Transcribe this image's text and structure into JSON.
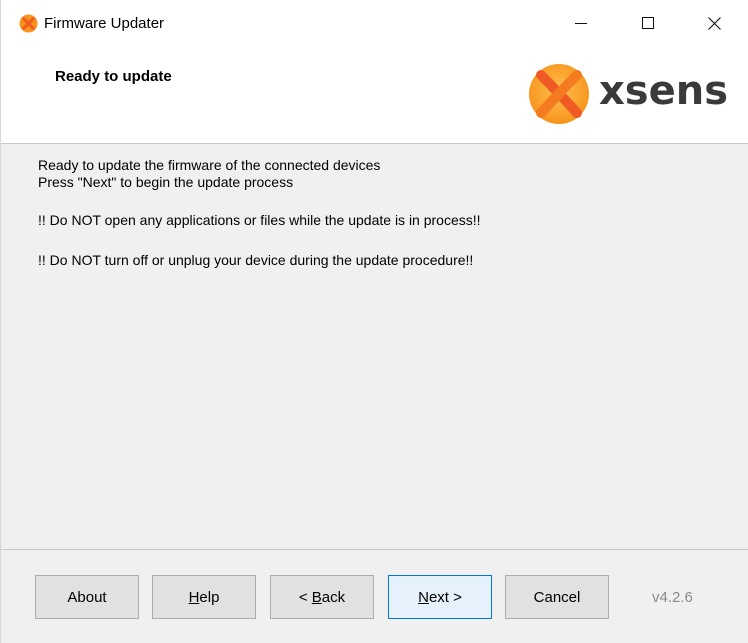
{
  "window": {
    "title": "Firmware Updater"
  },
  "header": {
    "title": "Ready to update",
    "logo_text": "xsens"
  },
  "content": {
    "line1": "Ready to update the firmware of the connected devices",
    "line2": "Press \"Next\" to begin the update process",
    "warning1": "!! Do NOT open any applications or files while the update is in process!!",
    "warning2": "!! Do NOT turn off or unplug your device during the update procedure!!"
  },
  "buttons": {
    "about": "About",
    "help_rest": "elp",
    "help_mnemonic": "H",
    "back_prefix": "< ",
    "back_mnemonic": "B",
    "back_rest": "ack",
    "next_mnemonic": "N",
    "next_rest": "ext >",
    "cancel": "Cancel"
  },
  "version": "v4.2.6",
  "colors": {
    "brand_orange": "#f7941d",
    "brand_text": "#3a3a3a",
    "focus_blue": "#0078d7"
  }
}
